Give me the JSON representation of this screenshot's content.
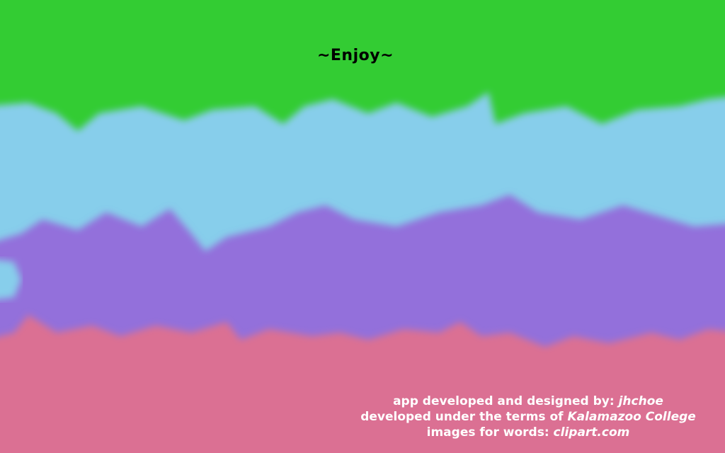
{
  "title": "~Enjoy~",
  "credits": {
    "line1_prefix": "app developed and designed by: ",
    "line1_name": "jhchoe",
    "line2_prefix": "developed under the terms of ",
    "line2_name": "Kalamazoo College",
    "line3_prefix": "images for words: ",
    "line3_name": "clipart.com"
  },
  "colors": {
    "green_band": "#33cc33",
    "sky_band": "#87ceeb",
    "purple_band": "#9370db",
    "pink_band": "#db7093",
    "title_text": "#000000",
    "credit_text": "#ffffff"
  }
}
